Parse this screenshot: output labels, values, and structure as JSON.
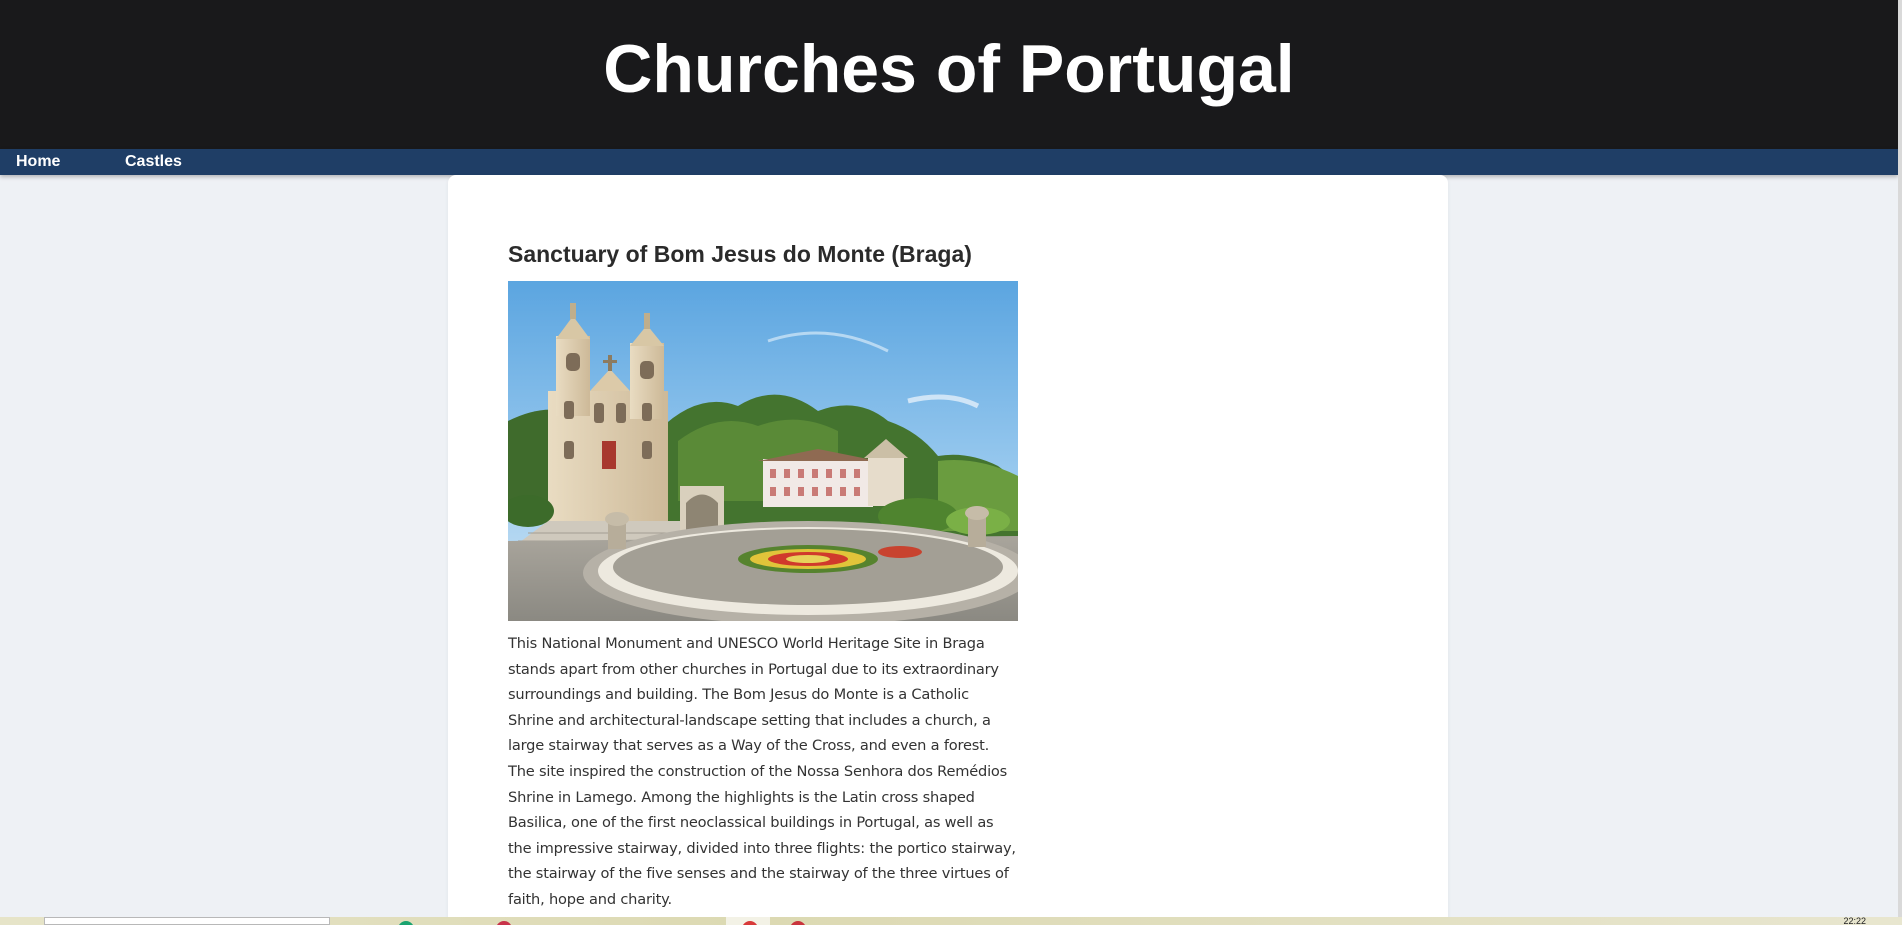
{
  "header": {
    "site_title": "Churches of Portugal"
  },
  "nav": {
    "items": [
      {
        "label": "Home"
      },
      {
        "label": "Castles"
      }
    ]
  },
  "article": {
    "title": "Sanctuary of Bom Jesus do Monte (Braga)",
    "image_alt": "Sanctuary of Bom Jesus do Monte",
    "body": "This National Monument and UNESCO World Heritage Site in Braga stands apart from other churches in Portugal due to its extraordinary surroundings and building. The Bom Jesus do Monte is a Catholic Shrine and architectural-landscape setting that includes a church, a large stairway that serves as a Way of the Cross, and even a forest. The site inspired the construction of the Nossa Senhora dos Remédios Shrine in Lamego. Among the highlights is the Latin cross shaped Basilica, one of the first neoclassical buildings in Portugal, as well as the impressive stairway, divided into three flights: the portico stairway, the stairway of the five senses and the stairway of the three virtues of faith, hope and charity."
  },
  "taskbar": {
    "clock": "22:22"
  },
  "colors": {
    "header_bg": "#19191b",
    "nav_bg": "#1f3e66",
    "page_bg": "#eef1f5",
    "card_bg": "#ffffff"
  }
}
